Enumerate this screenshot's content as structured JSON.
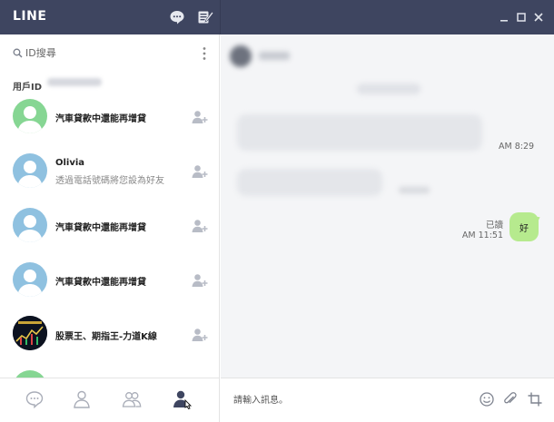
{
  "app": {
    "title": "LINE"
  },
  "search": {
    "placeholder": "ID搜尋"
  },
  "profile": {
    "user_id_label": "用戶ID"
  },
  "contacts": [
    {
      "name": "汽車貸款中還能再增貸",
      "subtitle": "",
      "avatar": "default-green"
    },
    {
      "name": "Olivia",
      "subtitle": "透過電話號碼將您設為好友",
      "avatar": "default-blue"
    },
    {
      "name": "汽車貸款中還能再增貸",
      "subtitle": "",
      "avatar": "default-blue"
    },
    {
      "name": "汽車貸款中還能再增貸",
      "subtitle": "",
      "avatar": "default-blue"
    },
    {
      "name": "股票王、期指王-力道K線",
      "subtitle": "",
      "avatar": "stock-chart"
    }
  ],
  "chat": {
    "received_time": "AM 8:29",
    "sent_message": "好",
    "sent_status": "已讀",
    "sent_time": "AM 11:51",
    "composer_placeholder": "請輸入訊息。"
  },
  "icons": {
    "titlebar": [
      "chat-bubble-icon",
      "edit-icon"
    ],
    "window": [
      "minimize-icon",
      "maximize-icon",
      "close-icon"
    ],
    "bottom_nav": [
      "chats-icon",
      "friend-icon",
      "group-icon",
      "add-friend-icon"
    ],
    "composer": [
      "emoji-icon",
      "attach-icon",
      "crop-icon"
    ]
  },
  "colors": {
    "titlebar": "#3e4560",
    "sent_bubble": "#b6ea8e",
    "avatar_green": "#86d693",
    "avatar_blue": "#8fc1e0"
  }
}
